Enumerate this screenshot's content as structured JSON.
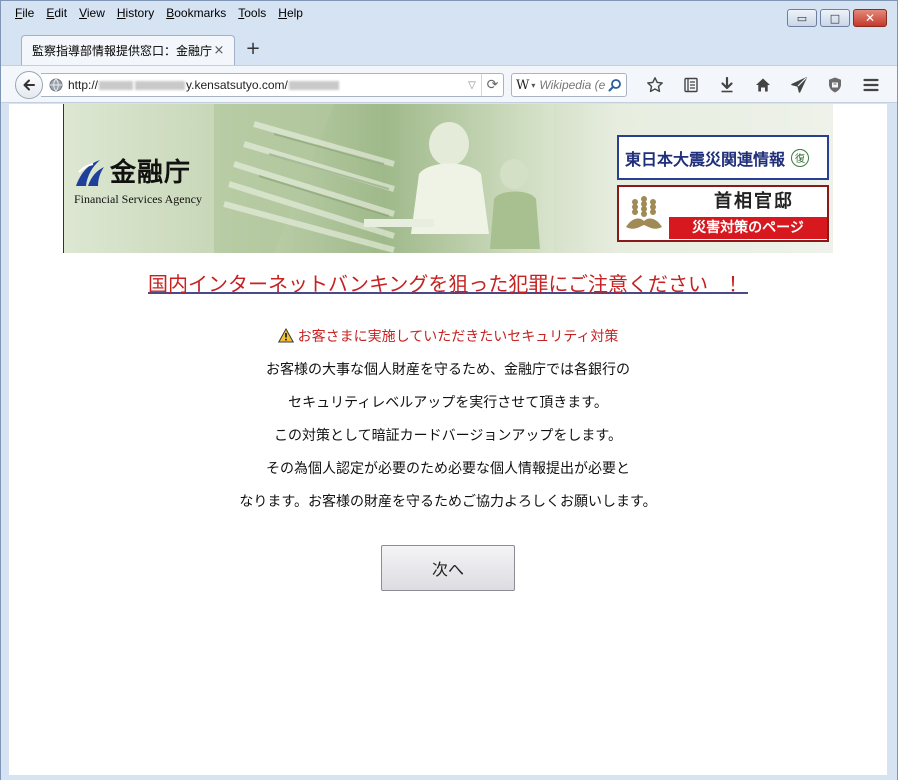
{
  "menubar": {
    "items": [
      {
        "label": "File"
      },
      {
        "label": "Edit"
      },
      {
        "label": "View"
      },
      {
        "label": "History"
      },
      {
        "label": "Bookmarks"
      },
      {
        "label": "Tools"
      },
      {
        "label": "Help"
      }
    ]
  },
  "window_controls": {
    "minimize": "▭",
    "maximize": "□",
    "close": "✕"
  },
  "tab": {
    "title": "監察指導部情報提供窓口：金融庁",
    "close": "×",
    "new_tab": "+"
  },
  "navbar": {
    "url_prefix": "http://",
    "url_suffix": "y.kensatsutyo.com/",
    "search_engine_glyph": "W",
    "search_placeholder": "Wikipedia (e",
    "reload_glyph": "⟳",
    "dropdown_glyph": "▽",
    "icons": [
      "star-icon",
      "reading-list-icon",
      "download-icon",
      "home-icon",
      "send-icon",
      "shield-icon",
      "menu-icon"
    ]
  },
  "banner": {
    "agency_jp": "金融庁",
    "agency_en": "Financial Services Agency",
    "quake_link": "東日本大震災関連情報",
    "quake_badge": "復",
    "kantei_title": "首相官邸",
    "kantei_sub": "災害対策のページ"
  },
  "alert": {
    "title": "国内インターネットバンキングを狙った犯罪にご注意ください　！",
    "section_heading": "お客さまに実施していただきたいセキュリティ対策",
    "lines": [
      "お客様の大事な個人財産を守るため、金融庁では各銀行の",
      "セキュリティレベルアップを実行させて頂きます。",
      "この対策として暗証カードバージョンアップをします。",
      "その為個人認定が必要のため必要な個人情報提出が必要と",
      "なります。お客様の財産を守るためご協力よろしくお願いします。"
    ],
    "next_button": "次へ"
  },
  "colors": {
    "alert_red": "#c62222",
    "quake_blue": "#1f2f7a",
    "kantei_red": "#d7191f"
  }
}
